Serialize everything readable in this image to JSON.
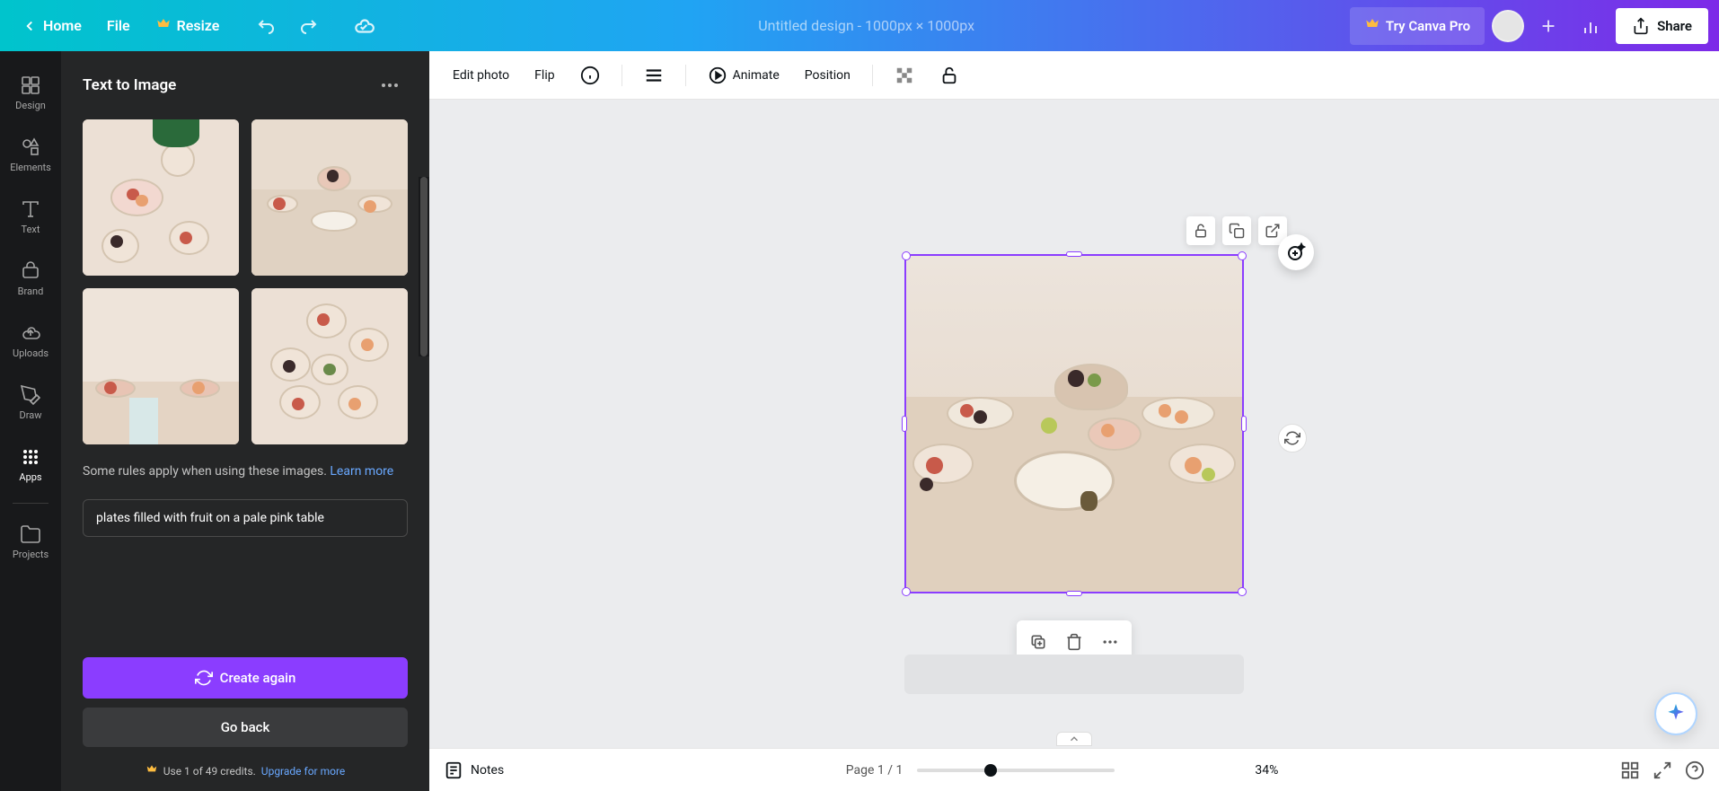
{
  "header": {
    "home": "Home",
    "file": "File",
    "resize": "Resize",
    "title": "Untitled design - 1000px × 1000px",
    "try_pro": "Try Canva Pro",
    "share": "Share"
  },
  "rail": {
    "items": [
      {
        "label": "Design"
      },
      {
        "label": "Elements"
      },
      {
        "label": "Text"
      },
      {
        "label": "Brand"
      },
      {
        "label": "Uploads"
      },
      {
        "label": "Draw"
      },
      {
        "label": "Apps"
      }
    ],
    "projects": "Projects"
  },
  "panel": {
    "title": "Text to Image",
    "rules_text": "Some rules apply when using these images. ",
    "learn_more": "Learn more",
    "prompt": "plates filled with fruit on a pale pink table",
    "create_again": "Create again",
    "go_back": "Go back",
    "credits": "Use 1 of 49 credits. ",
    "upgrade": "Upgrade for more"
  },
  "toolbar": {
    "edit_photo": "Edit photo",
    "flip": "Flip",
    "animate": "Animate",
    "position": "Position"
  },
  "bottom": {
    "notes": "Notes",
    "page_indicator": "Page 1 / 1",
    "zoom": "34%"
  }
}
